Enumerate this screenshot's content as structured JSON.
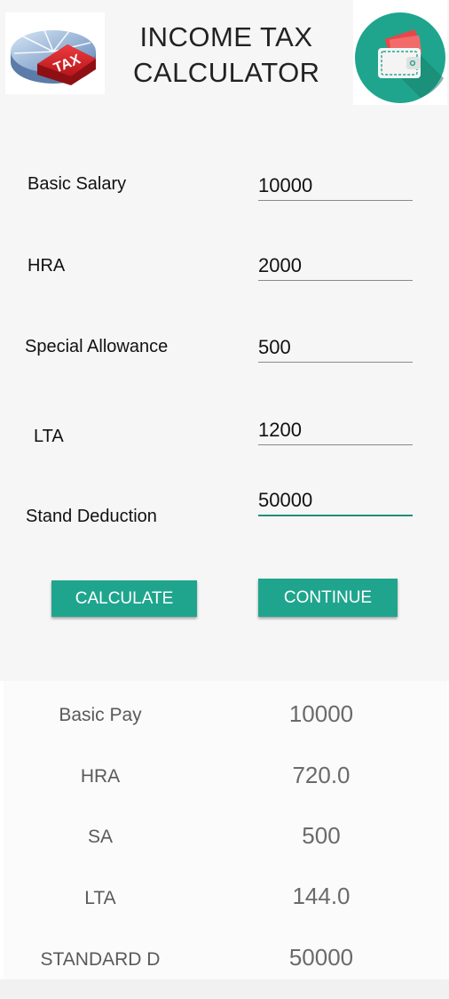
{
  "header": {
    "title_line1": "INCOME TAX",
    "title_line2": "CALCULATOR",
    "tax_logo_text": "TAX",
    "tax_logo_icon": "tax-pie-chart-icon",
    "wallet_logo_icon": "wallet-icon"
  },
  "form": {
    "basic_salary": {
      "label": "Basic Salary",
      "value": "10000"
    },
    "hra": {
      "label": "HRA",
      "value": "2000"
    },
    "special_allowance": {
      "label": "Special Allowance",
      "value": "500"
    },
    "lta": {
      "label": "LTA",
      "value": "1200"
    },
    "stand_deduction": {
      "label": "Stand Deduction",
      "value": "50000"
    }
  },
  "buttons": {
    "calculate": "CALCULATE",
    "continue": "CONTINUE"
  },
  "results": [
    {
      "label": "Basic Pay",
      "value": "10000"
    },
    {
      "label": "HRA",
      "value": "720.0"
    },
    {
      "label": "SA",
      "value": "500"
    },
    {
      "label": "LTA",
      "value": "144.0"
    },
    {
      "label": "STANDARD D",
      "value": "50000"
    }
  ],
  "colors": {
    "accent": "#1fa58d",
    "accent_underline": "#1f8f7a",
    "wallet_circle": "#1fa58d",
    "tax_red": "#d7262b"
  }
}
